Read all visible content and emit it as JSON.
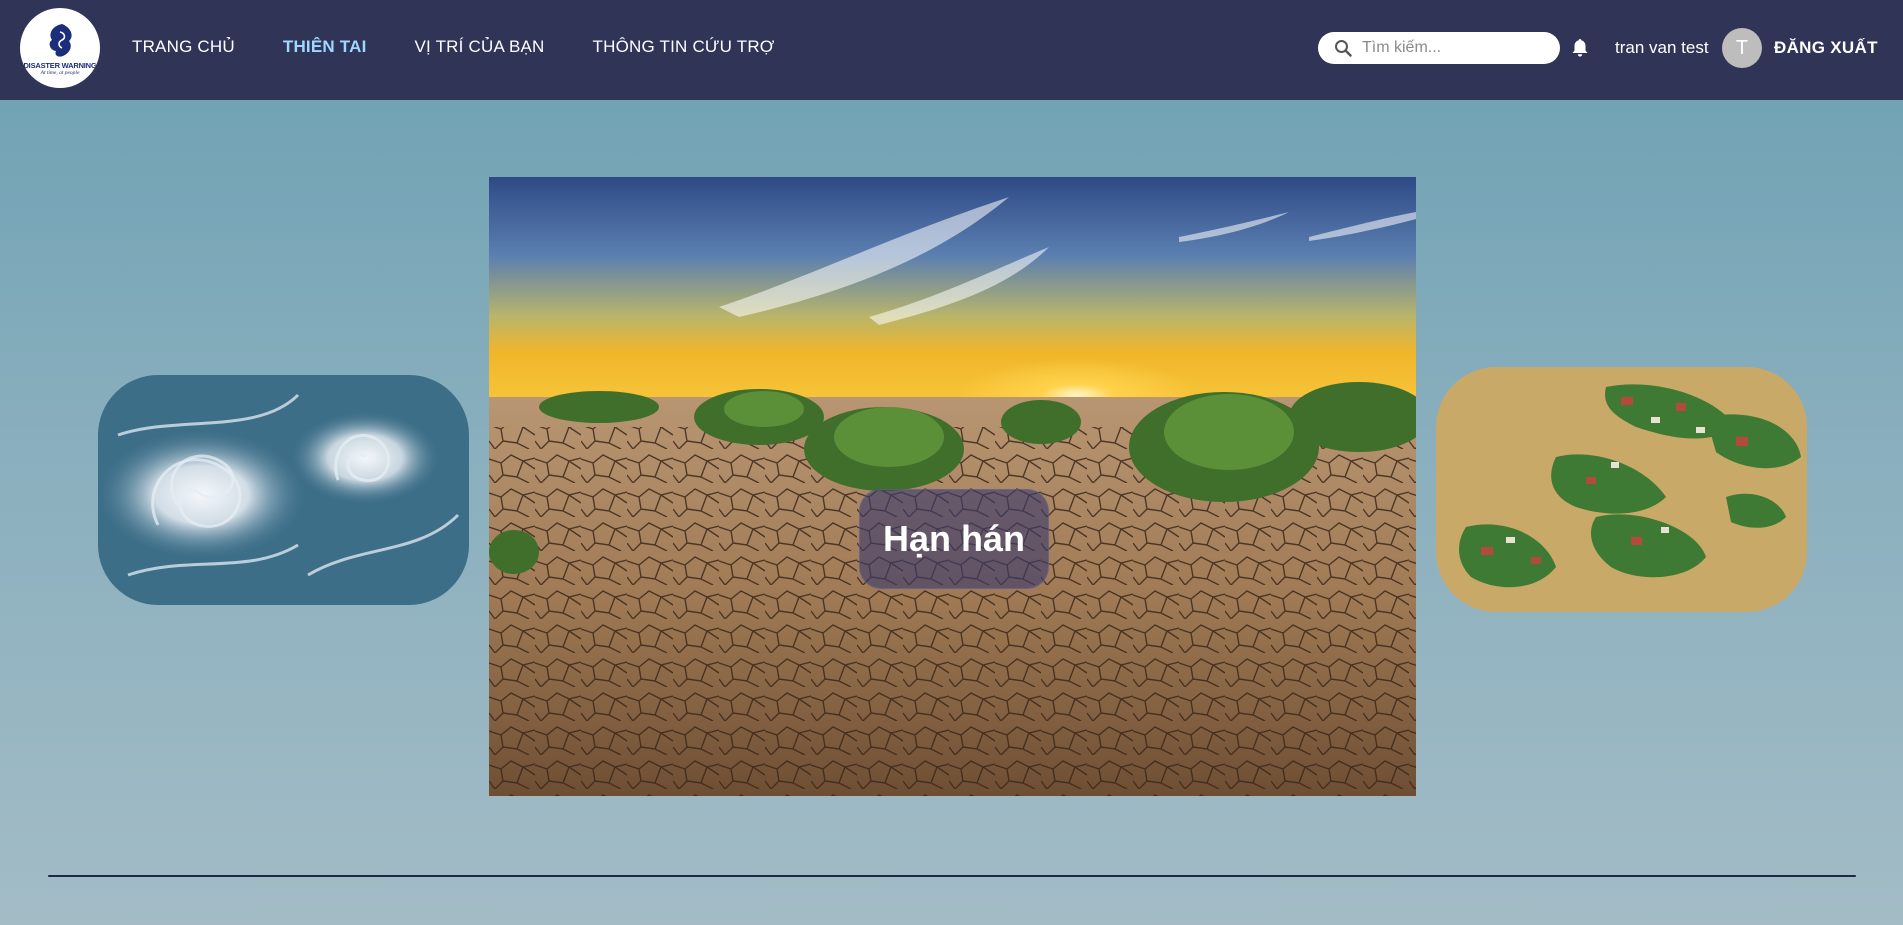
{
  "logo": {
    "title": "DISASTER WARNING",
    "subtitle": "At time, at people"
  },
  "nav": {
    "items": [
      {
        "label": "TRANG CHỦ",
        "active": false
      },
      {
        "label": "THIÊN TAI",
        "active": true
      },
      {
        "label": "VỊ TRÍ CỦA BẠN",
        "active": false
      },
      {
        "label": "THÔNG TIN CỨU TRỢ",
        "active": false
      }
    ]
  },
  "search": {
    "placeholder": "Tìm kiếm...",
    "value": ""
  },
  "user": {
    "name": "tran van test",
    "avatar_initial": "T",
    "logout_label": "ĐĂNG XUẤT"
  },
  "carousel": {
    "current_label": "Hạn hán",
    "slides": [
      {
        "icon": "hurricane-satellite-image"
      },
      {
        "icon": "drought-cracked-earth-image"
      },
      {
        "icon": "flood-aerial-image"
      }
    ]
  },
  "colors": {
    "navbar": "#303456",
    "active_nav": "#9fd8ff",
    "background_top": "#6a9fb2",
    "background_bottom": "#a3bcc6"
  }
}
